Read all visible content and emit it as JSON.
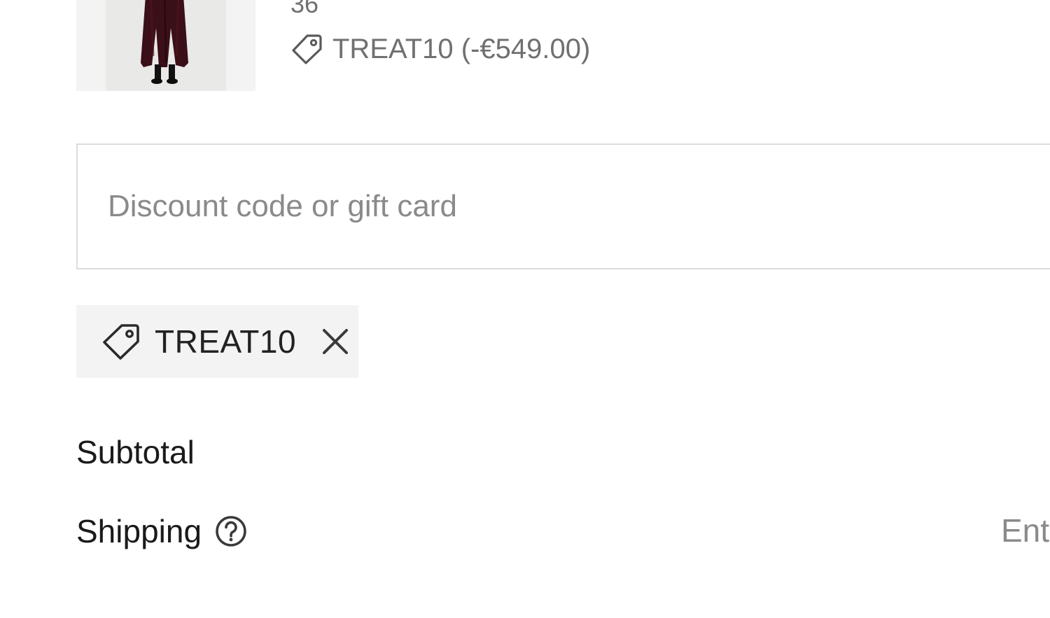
{
  "cart_item": {
    "image_alt": "Long burgundy coat product photo",
    "size": "36",
    "discount_text": "TREAT10 (-€549.00)",
    "discount_icon": "tag-icon"
  },
  "discount": {
    "placeholder": "Discount code or gift card",
    "value": ""
  },
  "applied_code": {
    "code": "TREAT10",
    "icon": "tag-icon",
    "remove_icon": "close-icon"
  },
  "summary": {
    "subtotal_label": "Subtotal",
    "shipping_label": "Shipping",
    "shipping_help_icon": "question-circle-icon",
    "shipping_value": "Ent"
  },
  "colors": {
    "chip_background": "#f3f3f3",
    "muted_text": "#707070",
    "border": "#dcdcdc"
  }
}
